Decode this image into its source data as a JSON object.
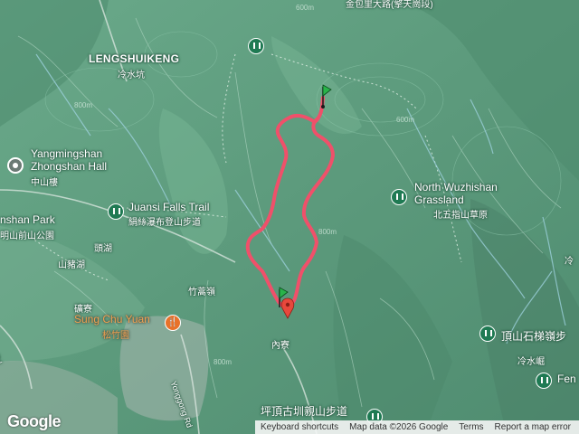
{
  "map": {
    "labels": {
      "top_road": "金包里大路(擎天崗段)",
      "lengshuikeng": "LENGSHUIKENG",
      "lengshuikeng_cjk": "冷水坑",
      "hall_en_1": "Yangmingshan",
      "hall_en_2": "Zhongshan Hall",
      "hall_cjk": "中山樓",
      "park_en": "nshan Park",
      "park_cjk": "明山前山公園",
      "juansi_en": "Juansi Falls Trail",
      "juansi_cjk": "絹絲瀑布登山步道",
      "wuzhishan_en_1": "North Wuzhishan",
      "wuzhishan_en_2": "Grassland",
      "wuzhishan_cjk": "北五指山草原",
      "toutou": "頭湖",
      "shanzhu": "山豬湖",
      "kuangliao": "礦寮",
      "zhuzihling": "竹蒿嶺",
      "neiliao": "內寮",
      "songzhu_en": "Sung Chu Yuan",
      "songzhu_cjk": "松竹園",
      "dingshan": "頂山石梯嶺步",
      "lengshuijue": "冷水崛",
      "fen": "Fen",
      "ping_trail": "坪頂古圳親山步道",
      "right_edge": "冷",
      "yongong_rd": "Yonggong Rd",
      "rd_left": "Rd"
    },
    "contours": [
      "600m",
      "800m",
      "600m",
      "800m",
      "800m"
    ],
    "route_color": "#f0506a",
    "start_marker_color": "#29b34a",
    "end_marker_color": "#e8483c",
    "attribution": {
      "google": "Google",
      "shortcuts": "Keyboard shortcuts",
      "map_data": "Map data ©2026 Google",
      "terms": "Terms",
      "report": "Report a map error"
    }
  }
}
